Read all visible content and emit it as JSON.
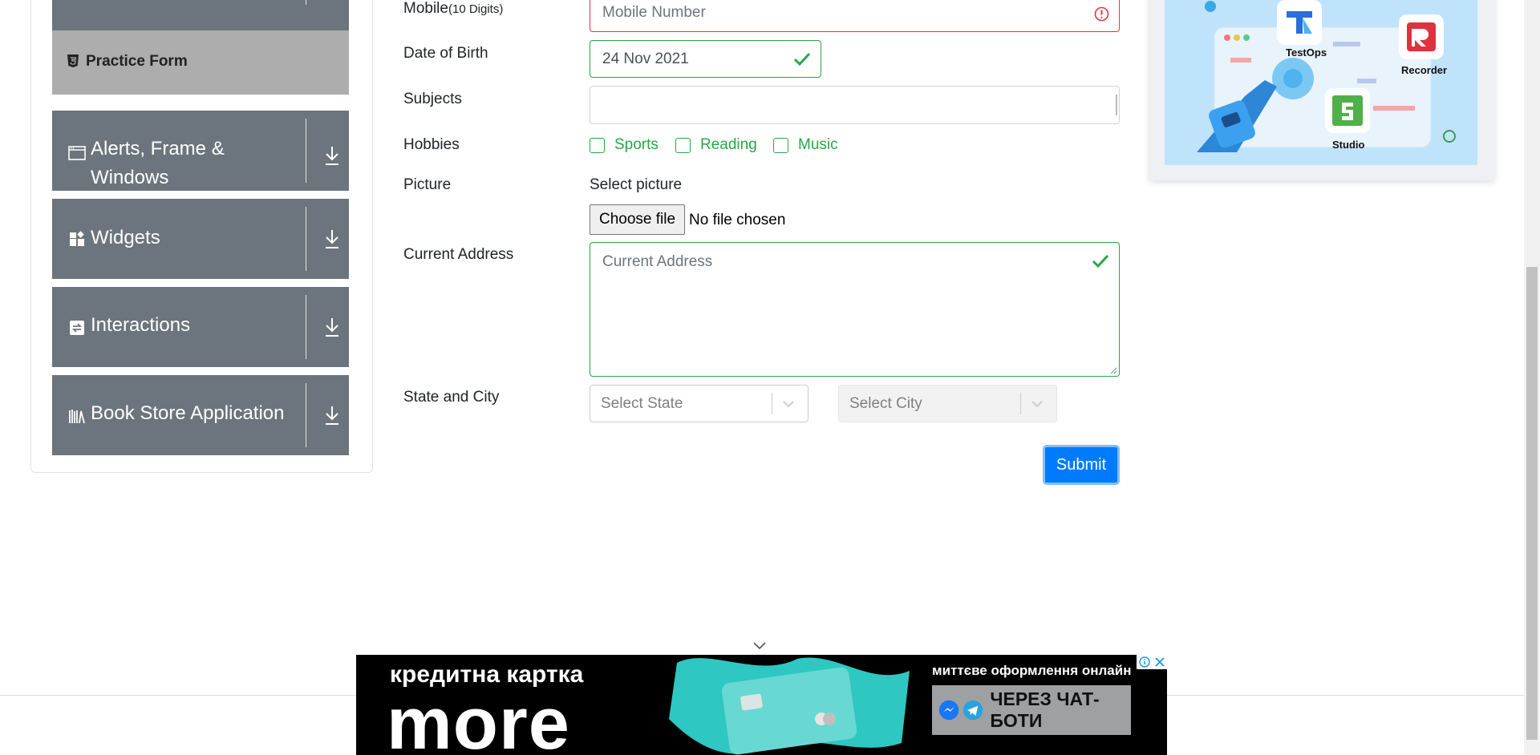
{
  "sidebar": {
    "practice_form_label": "Practice Form",
    "groups": [
      {
        "label_line1": "Alerts, Frame &",
        "label_line2": "Windows",
        "icon": "window-icon"
      },
      {
        "label": "Widgets",
        "icon": "widgets-icon"
      },
      {
        "label": "Interactions",
        "icon": "interactions-icon"
      },
      {
        "label": "Book Store Application",
        "icon": "books-icon"
      }
    ]
  },
  "form": {
    "mobile_label": "Mobile",
    "mobile_hint": "(10 Digits)",
    "mobile_placeholder": "Mobile Number",
    "dob_label": "Date of Birth",
    "dob_value": "24 Nov 2021",
    "subjects_label": "Subjects",
    "hobbies_label": "Hobbies",
    "hobbies": [
      "Sports",
      "Reading",
      "Music"
    ],
    "picture_label": "Picture",
    "picture_select_text": "Select picture",
    "choose_file_label": "Choose file",
    "no_file_text": "No file chosen",
    "address_label": "Current Address",
    "address_placeholder": "Current Address",
    "state_city_label": "State and City",
    "state_placeholder": "Select State",
    "city_placeholder": "Select City",
    "submit_label": "Submit"
  },
  "promo": {
    "items": [
      "TestOps",
      "Recorder",
      "Studio"
    ]
  },
  "ad": {
    "line1": "кредитна картка",
    "line2": "more",
    "line3": "миттєве оформлення онлайн",
    "button_text": "ЧЕРЕЗ ЧАТ-БОТИ"
  },
  "colors": {
    "sidebar_group": "#6c757d",
    "active_item": "#adadad",
    "valid": "#28a745",
    "invalid": "#dc3545",
    "primary": "#007bff"
  }
}
